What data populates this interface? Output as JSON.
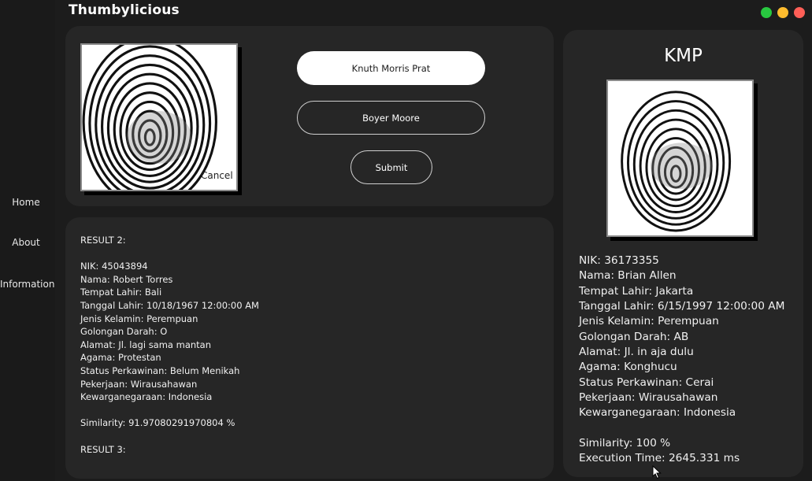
{
  "app": {
    "title": "Thumbylicious"
  },
  "window_controls": {
    "colors": [
      "#28c840",
      "#febc2e",
      "#ff5f57"
    ]
  },
  "sidebar": {
    "items": [
      {
        "label": "Home"
      },
      {
        "label": "About"
      },
      {
        "label": "Information"
      }
    ]
  },
  "input_panel": {
    "cancel_label": "Cancel",
    "algorithms": [
      {
        "label": "Knuth Morris Prat",
        "selected": true
      },
      {
        "label": "Boyer Moore",
        "selected": false
      }
    ],
    "submit_label": "Submit"
  },
  "results_panel": {
    "header_2": "RESULT 2:",
    "nik": "NIK: 45043894",
    "nama": "Nama: Robert Torres",
    "tempat_lahir": "Tempat Lahir: Bali",
    "tanggal_lahir": "Tanggal Lahir: 10/18/1967 12:00:00 AM",
    "jenis_kelamin": "Jenis Kelamin: Perempuan",
    "golongan_darah": "Golongan Darah: O",
    "alamat": "Alamat: Jl. lagi sama mantan",
    "agama": "Agama: Protestan",
    "status_perkawinan": "Status Perkawinan: Belum Menikah",
    "pekerjaan": "Pekerjaan: Wirausahawan",
    "kewarganegaraan": "Kewarganegaraan: Indonesia",
    "similarity": "Similarity: 91.97080291970804 %",
    "header_3": "RESULT 3:"
  },
  "match_panel": {
    "title": "KMP",
    "nik": "NIK: 36173355",
    "nama": "Nama: Brian Allen",
    "tempat_lahir": "Tempat Lahir: Jakarta",
    "tanggal_lahir": "Tanggal Lahir: 6/15/1997 12:00:00 AM",
    "jenis_kelamin": "Jenis Kelamin: Perempuan",
    "golongan_darah": "Golongan Darah: AB",
    "alamat": "Alamat: Jl. in aja dulu",
    "agama": "Agama: Konghucu",
    "status_perkawinan": "Status Perkawinan: Cerai",
    "pekerjaan": "Pekerjaan: Wirausahawan",
    "kewarganegaraan": "Kewarganegaraan: Indonesia",
    "similarity": "Similarity: 100 %",
    "execution_time": "Execution Time: 2645.331 ms"
  },
  "colors": {
    "background": "#1c1c1c",
    "panel": "#262626",
    "primary_button": "#ffffff"
  }
}
